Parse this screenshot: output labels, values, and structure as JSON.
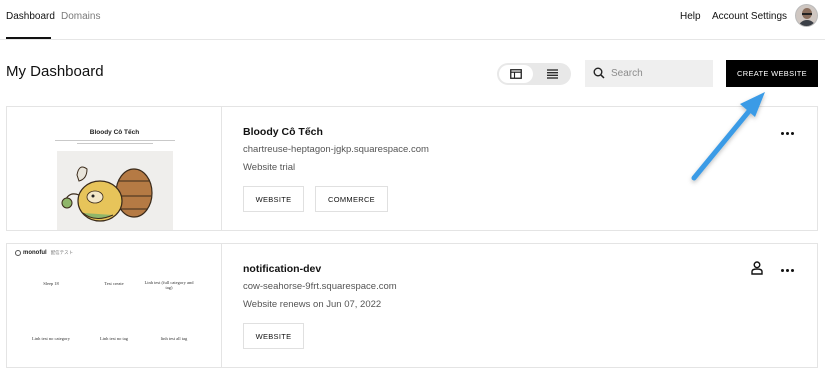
{
  "nav": {
    "tabs": [
      {
        "label": "Dashboard",
        "active": true
      },
      {
        "label": "Domains",
        "active": false
      }
    ],
    "help": "Help",
    "account_settings": "Account Settings"
  },
  "header": {
    "title": "My Dashboard",
    "search_placeholder": "Search",
    "create_button": "CREATE WEBSITE"
  },
  "colors": {
    "accent_black": "#000000",
    "annotation_arrow": "#3a9be6"
  },
  "sites": [
    {
      "name": "Bloody Cô Tếch",
      "domain": "chartreuse-heptagon-jgkp.squarespace.com",
      "status": "Website trial",
      "buttons": [
        "WEBSITE",
        "COMMERCE"
      ],
      "preview": {
        "title": "Bloody Cô Tếch"
      }
    },
    {
      "name": "notification-dev",
      "domain": "cow-seahorse-9frt.squarespace.com",
      "status": "Website renews on Jun 07, 2022",
      "buttons": [
        "WEBSITE"
      ],
      "preview": {
        "brand": "monoful",
        "brand_sub": "配信テスト",
        "items": [
          "Sleep 18",
          "Test create",
          "Linh test (full category and tag)",
          "Linh test no category",
          "Linh test no tag",
          "linh test all tag"
        ]
      }
    }
  ]
}
